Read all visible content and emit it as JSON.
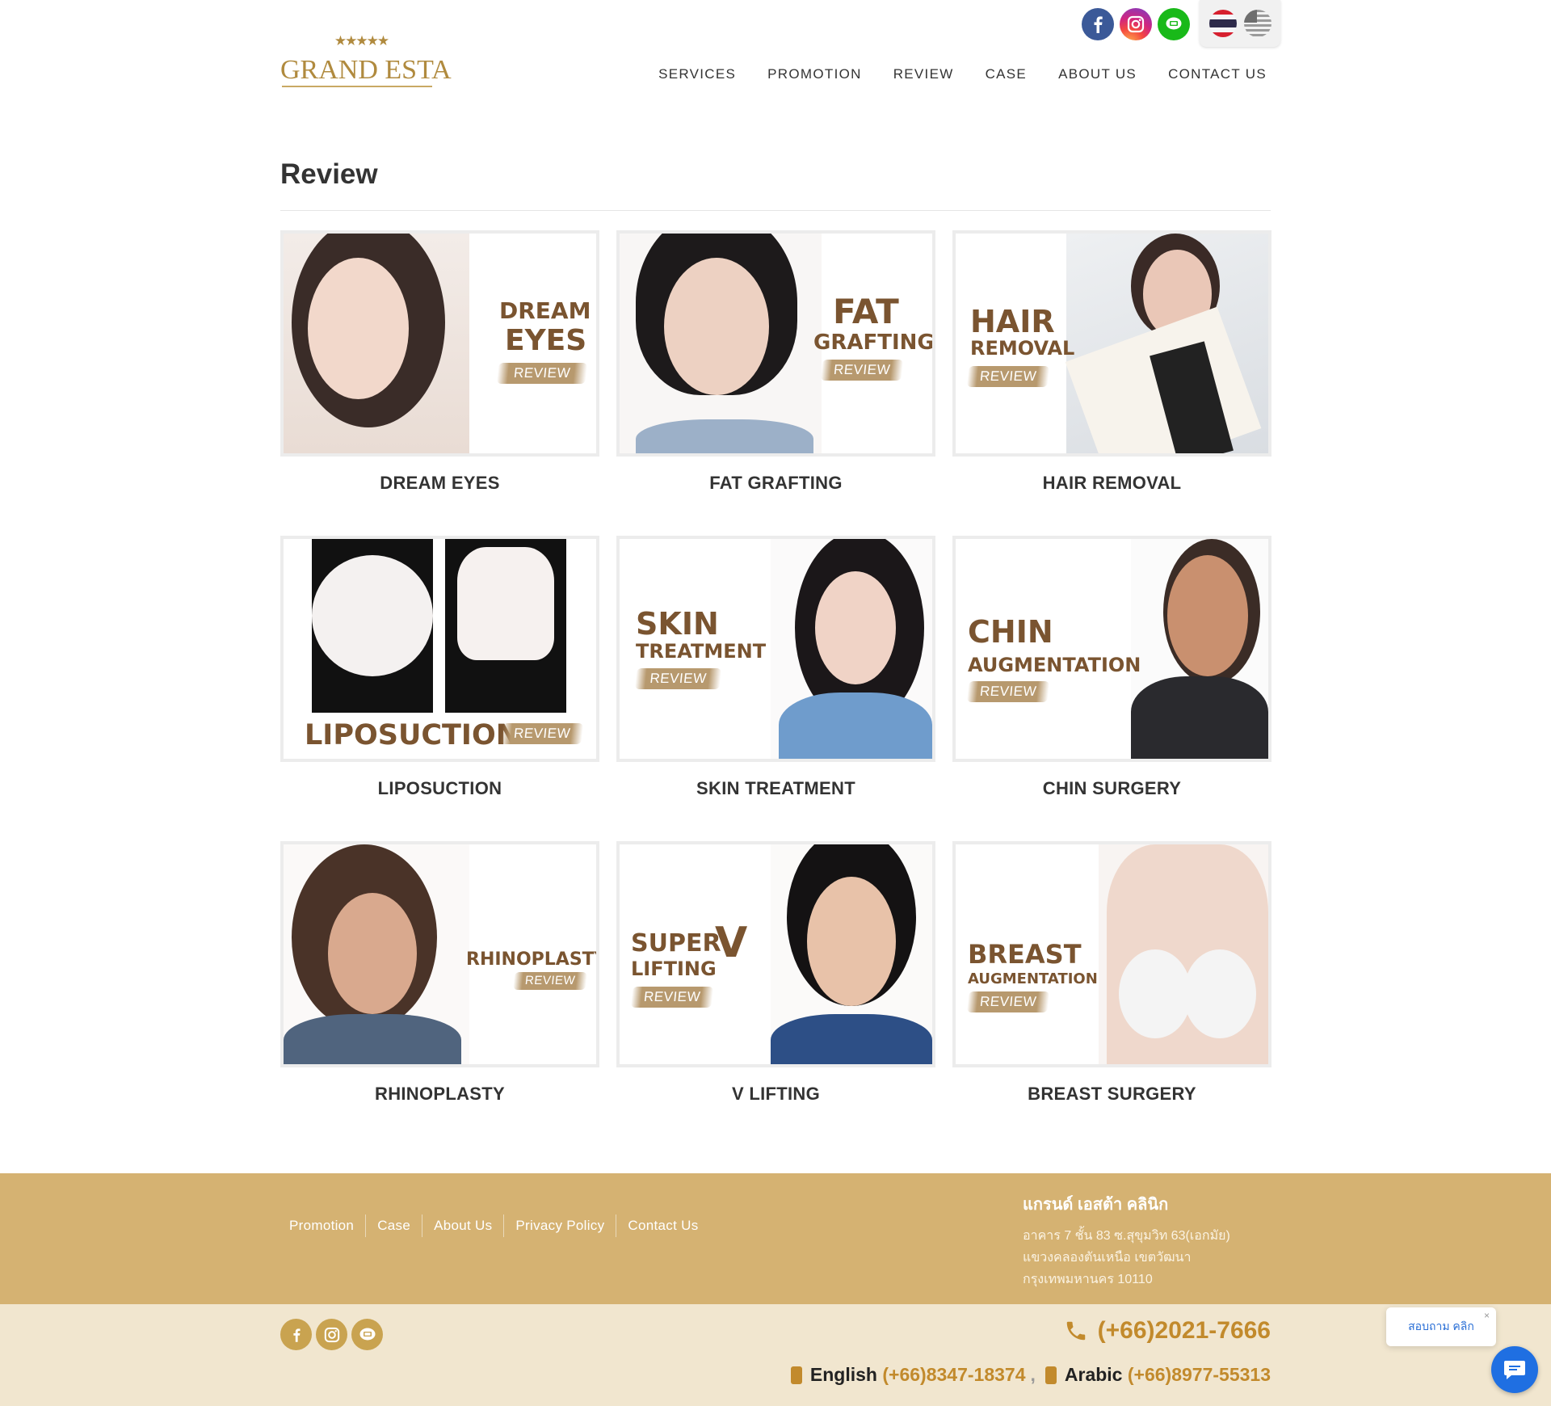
{
  "brand": {
    "name": "GRAND ESTA",
    "stars": "★★★★★"
  },
  "nav": {
    "items": [
      "SERVICES",
      "PROMOTION",
      "REVIEW",
      "CASE",
      "ABOUT US",
      "CONTACT US"
    ]
  },
  "page": {
    "title": "Review"
  },
  "cards": [
    {
      "caption": "DREAM EYES",
      "overlay_l1": "DREAM",
      "overlay_l2": "EYES",
      "badge": "REVIEW"
    },
    {
      "caption": "FAT GRAFTING",
      "overlay_l1": "FAT",
      "overlay_l2": "GRAFTING",
      "badge": "REVIEW"
    },
    {
      "caption": "HAIR REMOVAL",
      "overlay_l1": "HAIR",
      "overlay_l2": "REMOVAL",
      "badge": "REVIEW"
    },
    {
      "caption": "LIPOSUCTION",
      "overlay_l1": "LIPOSUCTION",
      "overlay_l2": "",
      "badge": "REVIEW"
    },
    {
      "caption": "SKIN TREATMENT",
      "overlay_l1": "SKIN",
      "overlay_l2": "TREATMENT",
      "badge": "REVIEW"
    },
    {
      "caption": "CHIN SURGERY",
      "overlay_l1": "CHIN",
      "overlay_l2": "AUGMENTATION",
      "badge": "REVIEW"
    },
    {
      "caption": "RHINOPLASTY",
      "overlay_l1": "RHINOPLASTY",
      "overlay_l2": "",
      "badge": "REVIEW"
    },
    {
      "caption": "V LIFTING",
      "overlay_l1": "SUPER",
      "overlay_l1b": "V",
      "overlay_l2": "LIFTING",
      "badge": "REVIEW"
    },
    {
      "caption": "BREAST SURGERY",
      "overlay_l1": "BREAST",
      "overlay_l2": "AUGMENTATION",
      "badge": "REVIEW"
    }
  ],
  "footer": {
    "links": [
      "Promotion",
      "Case",
      "About Us",
      "Privacy Policy",
      "Contact Us"
    ],
    "clinic_name": "แกรนด์ เอสต้า คลินิก",
    "address": [
      "อาคาร 7 ชั้น 83 ซ.สุขุมวิท 63(เอกมัย)",
      "แขวงคลองตันเหนือ เขตวัฒนา",
      "กรุงเทพมหานคร 10110"
    ],
    "phone_main": "(+66)2021-7666",
    "english_label": "English",
    "english_phone": "(+66)8347-18374",
    "separator": ",",
    "arabic_label": "Arabic",
    "arabic_phone": "(+66)8977-55313"
  },
  "chat": {
    "bubble_text": "สอบถาม คลิก",
    "close": "×"
  },
  "colors": {
    "gold": "#b08a3e",
    "footer_gold": "#d5b272",
    "footer_cream": "#f1e6cf",
    "text_brown": "#7a5430",
    "phone": "#c28a2c"
  },
  "icons": [
    "facebook-icon",
    "instagram-icon",
    "line-icon",
    "thai-flag-icon",
    "us-flag-icon",
    "phone-icon",
    "mobile-icon",
    "chat-icon"
  ]
}
